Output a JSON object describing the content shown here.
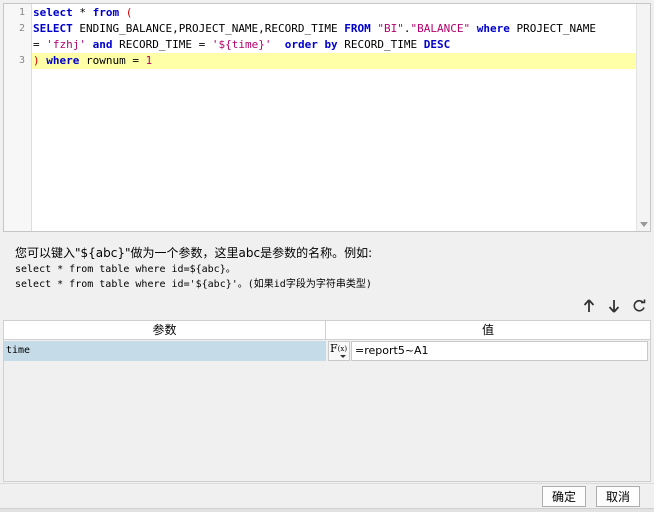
{
  "editor": {
    "line_numbers": [
      "1",
      "2",
      "3"
    ],
    "lines": [
      [
        {
          "t": "select",
          "c": "kw"
        },
        {
          "t": " * ",
          "c": "plain"
        },
        {
          "t": "from",
          "c": "kw"
        },
        {
          "t": " (",
          "c": "paren"
        }
      ],
      [
        {
          "t": "SELECT",
          "c": "kw"
        },
        {
          "t": " ENDING_BALANCE,PROJECT_NAME,RECORD_TIME ",
          "c": "plain"
        },
        {
          "t": "FROM",
          "c": "kw"
        },
        {
          "t": " ",
          "c": "plain"
        },
        {
          "t": "\"BI\"",
          "c": "str"
        },
        {
          "t": ".",
          "c": "plain"
        },
        {
          "t": "\"BALANCE\"",
          "c": "str"
        },
        {
          "t": " ",
          "c": "plain"
        },
        {
          "t": "where",
          "c": "kw"
        },
        {
          "t": " PROJECT_NAME",
          "c": "plain"
        }
      ],
      [
        {
          "t": "= ",
          "c": "plain"
        },
        {
          "t": "'fzhj'",
          "c": "str"
        },
        {
          "t": " ",
          "c": "plain"
        },
        {
          "t": "and",
          "c": "kw"
        },
        {
          "t": " RECORD_TIME = ",
          "c": "plain"
        },
        {
          "t": "'${time}'",
          "c": "str"
        },
        {
          "t": "  ",
          "c": "plain"
        },
        {
          "t": "order by",
          "c": "kw"
        },
        {
          "t": " RECORD_TIME ",
          "c": "plain"
        },
        {
          "t": "DESC",
          "c": "kw"
        }
      ],
      [
        {
          "t": ")",
          "c": "paren"
        },
        {
          "t": " ",
          "c": "plain"
        },
        {
          "t": "where",
          "c": "kw"
        },
        {
          "t": " rownum = ",
          "c": "plain"
        },
        {
          "t": "1",
          "c": "num"
        }
      ]
    ]
  },
  "hint": {
    "title": "您可以键入\"${abc}\"做为一个参数，这里abc是参数的名称。例如:",
    "example1": "select * from table where id=${abc}。",
    "example2": "select * from table where id='${abc}'。(如果id字段为字符串类型)"
  },
  "toolbar": {
    "icons": [
      "arrow-up-icon",
      "arrow-down-icon",
      "refresh-icon"
    ]
  },
  "params_table": {
    "headers": {
      "param": "参数",
      "value": "值"
    },
    "rows": [
      {
        "name": "time",
        "value": "=report5~A1"
      }
    ],
    "formula_button": {
      "label": "F",
      "sub": "(x)"
    }
  },
  "buttons": {
    "ok": "确定",
    "cancel": "取消"
  }
}
